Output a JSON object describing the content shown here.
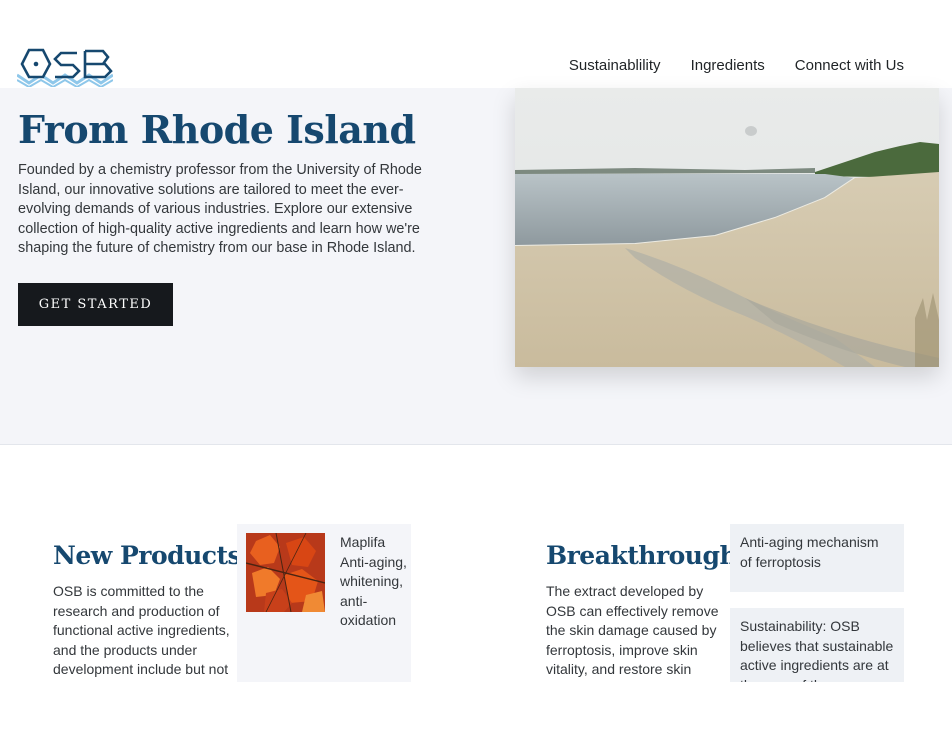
{
  "header": {
    "logo_icon": "osb-hexagon-logo",
    "nav": [
      {
        "label": "Sustainablility"
      },
      {
        "label": "Ingredients"
      },
      {
        "label": "Connect with Us"
      }
    ]
  },
  "hero": {
    "title": "From Rhode Island",
    "text": "Founded by a chemistry professor from the University of Rhode Island, our innovative solutions are tailored to meet the ever-evolving demands of various industries. Explore our extensive collection of high-quality active ingredients and learn how we're shaping the future of chemistry from our base in Rhode Island.",
    "cta_label": "GET STARTED",
    "photo_icon": "beach-shoreline-photo"
  },
  "new_products": {
    "title": "New Products",
    "text": "OSB is committed to the research and production of functional active ingredients, and the products under development include but not",
    "card": {
      "thumb_icon": "red-maple-leaves-photo",
      "text": "Maplifa Anti-aging, whitening, anti-oxidation"
    }
  },
  "breakthrough": {
    "title": "Breakthrough",
    "text": "The extract developed by OSB can effectively remove the skin damage caused by ferroptosis, improve skin vitality, and restore skin",
    "card1": "Anti-aging mechanism of ferroptosis",
    "card2": "Sustainability: OSB believes that sustainable active ingredients are at the core of the"
  },
  "colors": {
    "brand_blue": "#16486f",
    "hero_bg": "#f4f5f9",
    "button_bg": "#16191d",
    "card_bg": "#eef1f5"
  }
}
